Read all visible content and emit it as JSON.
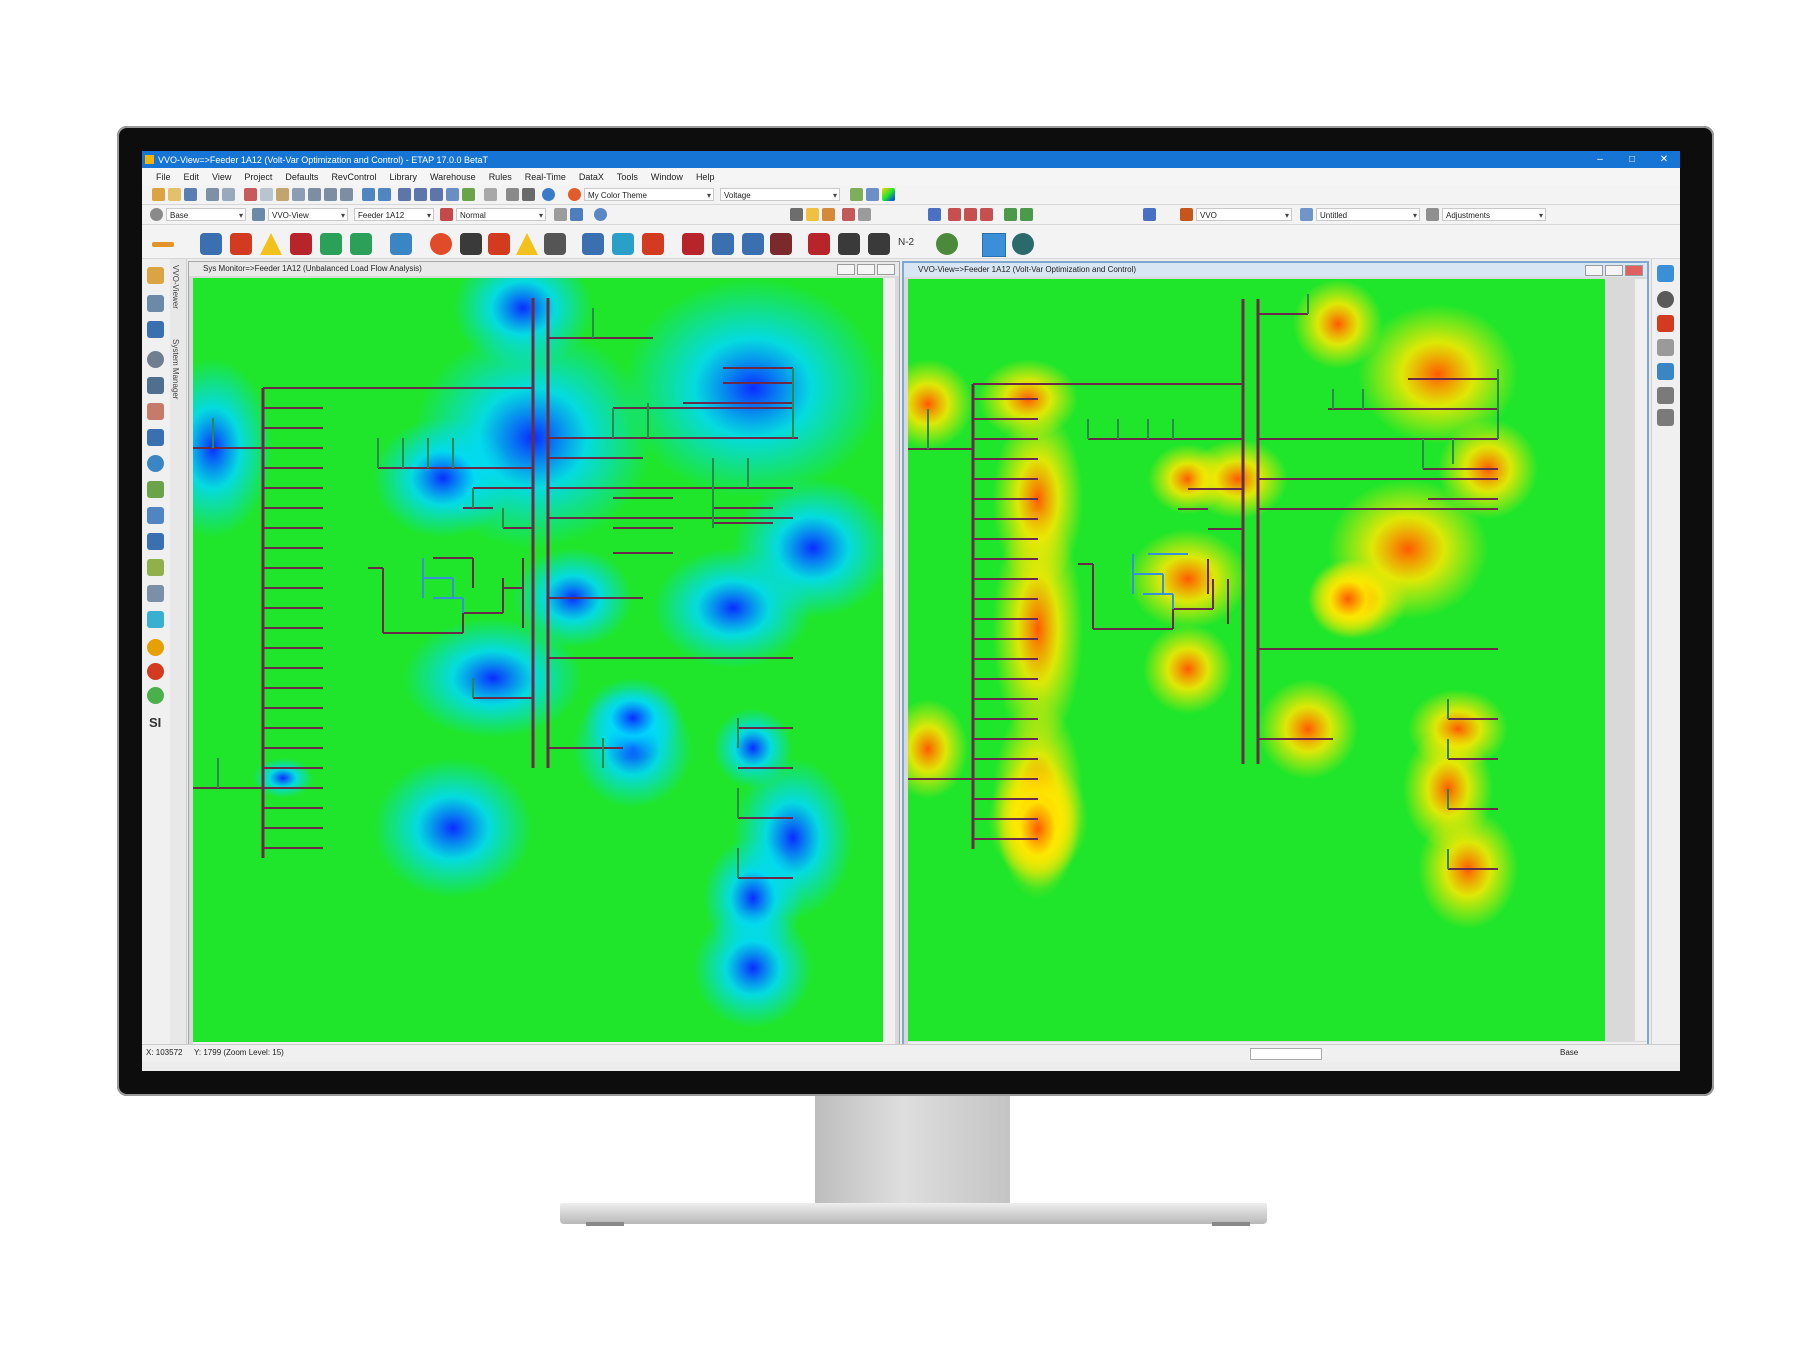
{
  "window": {
    "title": "VVO-View=>Feeder 1A12 (Volt-Var Optimization and Control) - ETAP 17.0.0 BetaT",
    "controls": [
      "–",
      "□",
      "✕"
    ]
  },
  "menu": [
    "File",
    "Edit",
    "View",
    "Project",
    "Defaults",
    "RevControl",
    "Library",
    "Warehouse",
    "Rules",
    "Real-Time",
    "DataX",
    "Tools",
    "Window",
    "Help"
  ],
  "toolbar1": {
    "theme_combo": "My Color Theme",
    "display_combo": "Voltage"
  },
  "toolbar2": {
    "base_combo": "Base",
    "view_combo": "VVO-View",
    "feeder_combo": "Feeder 1A12",
    "config_combo": "Normal",
    "study_combo": "VVO",
    "case_combo": "Untitled",
    "adjust_combo": "Adjustments"
  },
  "toolbar3": {
    "n2_label": "N-2"
  },
  "left_toolbar": {
    "vertical_tab_1": "VVO-Viewer",
    "vertical_tab_2": "System Manager",
    "si_label": "SI"
  },
  "left_pane": {
    "title": "Sys Monitor=>Feeder 1A12 (Unbalanced Load Flow Analysis)"
  },
  "right_pane": {
    "title": "VVO-View=>Feeder 1A12 (Volt-Var Optimization and Control)"
  },
  "statusbar": {
    "x": "X: 103572",
    "y": "Y: 1799 (Zoom Level: 15)",
    "mode": "Base"
  },
  "colors": {
    "titlebar": "#1674d4",
    "heat_low": "#0a2cff",
    "heat_mid": "#1fe62a",
    "heat_high": "#ff5a00",
    "one_line_bus": "#6b2a4a",
    "one_line_source": "#2a8a4a",
    "optimized_path": "#3a8fd6"
  }
}
